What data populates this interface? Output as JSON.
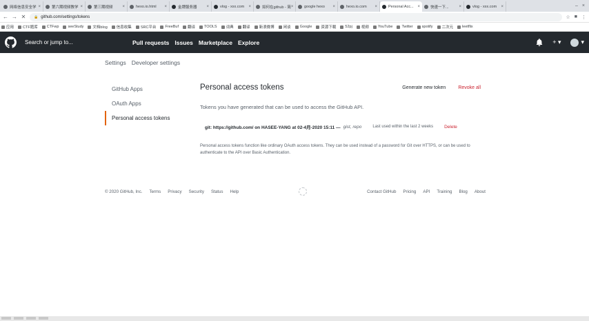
{
  "browser": {
    "tabs": [
      {
        "label": "网络信息安全学",
        "active": false
      },
      {
        "label": "第六期视频教学",
        "active": false
      },
      {
        "label": "第三期视频",
        "active": false
      },
      {
        "label": "hexo.io.html",
        "active": false
      },
      {
        "label": "金牌服务器",
        "active": false
      },
      {
        "label": "vlog - xxx.com",
        "active": false
      },
      {
        "label": "如何在github - 简",
        "active": false
      },
      {
        "label": "google hexo",
        "active": false
      },
      {
        "label": "hexo.io.com",
        "active": false
      },
      {
        "label": "Personal Acc...",
        "active": true
      },
      {
        "label": "快速一下...",
        "active": false
      },
      {
        "label": "vlog - xxx.com",
        "active": false
      }
    ],
    "url": "github.com/settings/tokens",
    "bookmarks": [
      "应用",
      "CTF题库",
      "CTFwp",
      "seeStudy",
      "文档blog",
      "信息收集",
      "SRC平台",
      "FreeBuf",
      "翻译",
      "TOOLS",
      "词典",
      "翻译",
      "新浪微博",
      "闲谈",
      "Google",
      "资源下载",
      "52pj",
      "视频",
      "YouTube",
      "Twitter",
      "spotify",
      "二次元",
      "leetflix"
    ]
  },
  "github_header": {
    "search_placeholder": "Search or jump to...",
    "nav": [
      "Pull requests",
      "Issues",
      "Marketplace",
      "Explore"
    ],
    "bell_icon": "bell-icon",
    "plus_label": "+ ▾",
    "avatar_label": "▾"
  },
  "breadcrumb": {
    "settings": "Settings",
    "developer": "Developer settings"
  },
  "sidebar": {
    "items": [
      {
        "label": "GitHub Apps"
      },
      {
        "label": "OAuth Apps"
      },
      {
        "label": "Personal access tokens"
      }
    ]
  },
  "main": {
    "title": "Personal access tokens",
    "generate_label": "Generate new token",
    "revoke_label": "Revoke all",
    "intro": "Tokens you have generated that can be used to access the GitHub API.",
    "token": {
      "name": "git: https://github.com/ on HASEE-YANG at 02-4月-2020 15:11 —",
      "scope": "gist, repo",
      "last_used": "Last used within the last 2 weeks",
      "delete_label": "Delete"
    },
    "note": "Personal access tokens function like ordinary OAuth access tokens. They can be used instead of a password for Git over HTTPS, or can be used to authenticate to the API over Basic Authentication."
  },
  "footer": {
    "copyright": "© 2020 GitHub, Inc.",
    "left_links": [
      "Terms",
      "Privacy",
      "Security",
      "Status",
      "Help"
    ],
    "right_links": [
      "Contact GitHub",
      "Pricing",
      "API",
      "Training",
      "Blog",
      "About"
    ]
  }
}
